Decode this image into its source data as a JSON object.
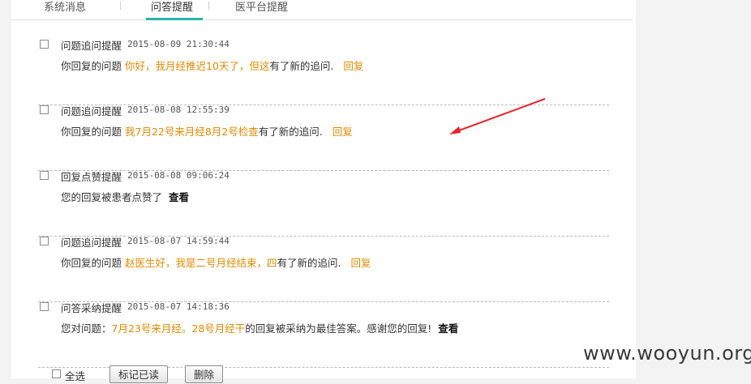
{
  "tabs": [
    {
      "label": "系统消息",
      "active": false
    },
    {
      "label": "问答提醒",
      "active": true
    },
    {
      "label": "医平台提醒",
      "active": false
    }
  ],
  "notifications": [
    {
      "type": "问题追问提醒",
      "time": "2015-08-09 21:30:44",
      "prefix": "你回复的问题",
      "highlight": "你好，我月经推迟10天了，但这",
      "suffix": "有了新的追问.",
      "action": "回复"
    },
    {
      "type": "问题追问提醒",
      "time": "2015-08-08 12:55:39",
      "prefix": "你回复的问题",
      "highlight": "我7月22号来月经8月2号检查",
      "suffix": "有了新的追问.",
      "action": "回复"
    },
    {
      "type": "回复点赞提醒",
      "time": "2015-08-08 09:06:24",
      "prefix": "您的回复被患者点赞了",
      "highlight": "",
      "suffix": "",
      "action": "查看"
    },
    {
      "type": "问题追问提醒",
      "time": "2015-08-07 14:59:44",
      "prefix": "你回复的问题",
      "highlight": "赵医生好，我是二号月经结束，四",
      "suffix": "有了新的追问.",
      "action": "回复"
    },
    {
      "type": "问答采纳提醒",
      "time": "2015-08-07 14:18:36",
      "prefix": "您对问题：",
      "highlight": "7月23号来月经。28号月经干",
      "suffix": "的回复被采纳为最佳答案。感谢您的回复!",
      "action": "查看"
    }
  ],
  "footer": {
    "select_all": "全选",
    "mark_read": "标记已读",
    "delete": "删除"
  },
  "watermark": "www.wooyun.org",
  "colors": {
    "accent": "#27b3a8",
    "highlight": "#e08a00",
    "arrow": "#e8232a"
  }
}
